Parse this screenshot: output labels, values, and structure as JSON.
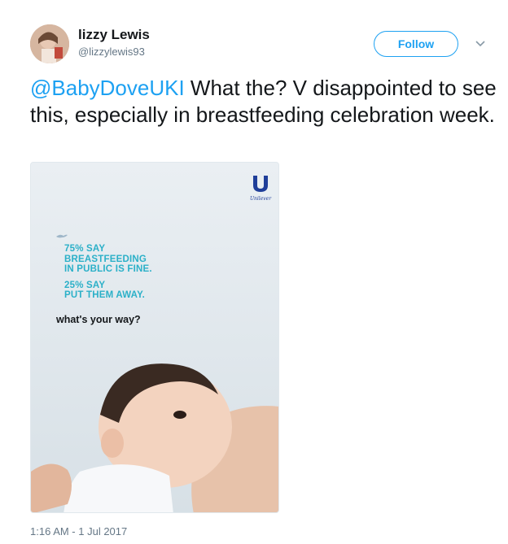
{
  "author": {
    "display_name": "lizzy Lewis",
    "handle": "@lizzylewis93"
  },
  "follow_label": "Follow",
  "tweet": {
    "mention": "@BabyDoveUKI",
    "text": " What the? V disappointed to see this, especially in breastfeeding celebration week."
  },
  "ad": {
    "brand": "Unilever",
    "line1": "75% SAY",
    "line2": "BREASTFEEDING",
    "line3": "IN PUBLIC IS FINE.",
    "line4": "25% SAY",
    "line5": "PUT THEM AWAY.",
    "question": "what's your way?"
  },
  "timestamp": "1:16 AM - 1 Jul 2017",
  "colors": {
    "accent": "#1da1f2",
    "ad_text": "#2bb0c8",
    "logo": "#1f3e99"
  }
}
